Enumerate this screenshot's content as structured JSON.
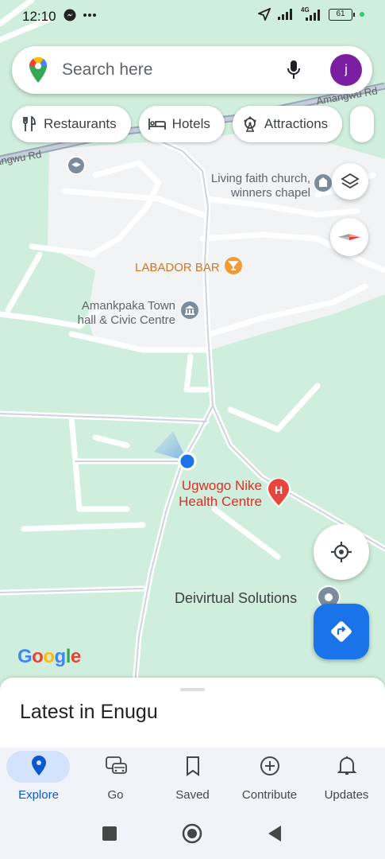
{
  "status_bar": {
    "time": "12:10",
    "network": "4G",
    "battery": "61",
    "icons": [
      "messenger-icon",
      "more-dots-icon",
      "location-arrow-icon",
      "signal-icon",
      "signal-4g-icon",
      "battery-icon"
    ]
  },
  "search": {
    "placeholder": "Search here",
    "avatar_letter": "j",
    "avatar_color": "#7b1fa2"
  },
  "chips": [
    {
      "label": "Restaurants",
      "icon": "fork-knife-icon"
    },
    {
      "label": "Hotels",
      "icon": "bed-icon"
    },
    {
      "label": "Attractions",
      "icon": "ferris-wheel-icon"
    }
  ],
  "map": {
    "road_labels": [
      "Amangwu Rd",
      "angwu Rd"
    ],
    "places": [
      {
        "name": "Living faith church,",
        "name2": "winners chapel",
        "icon": "church-icon"
      },
      {
        "name": "LABADOR BAR",
        "icon": "cocktail-icon"
      },
      {
        "name": "Amankpaka Town",
        "name2": "hall & Civic Centre",
        "icon": "city-hall-icon"
      },
      {
        "name": "Ugwogo Nike",
        "name2": "Health Centre",
        "icon": "hospital-icon"
      },
      {
        "name": "Deivirtual Solutions",
        "icon": "place-pin-icon"
      }
    ],
    "attribution": "Google"
  },
  "sheet": {
    "title": "Latest in Enugu"
  },
  "nav": [
    {
      "label": "Explore",
      "icon": "explore-pin-icon",
      "active": true
    },
    {
      "label": "Go",
      "icon": "car-icon"
    },
    {
      "label": "Saved",
      "icon": "bookmark-icon"
    },
    {
      "label": "Contribute",
      "icon": "add-circle-icon"
    },
    {
      "label": "Updates",
      "icon": "bell-icon"
    }
  ],
  "colors": {
    "accent": "#1a73e8",
    "map_green": "#cfeedd",
    "map_urban": "#f1f3f4",
    "hospital": "#e8453c",
    "bar": "#f29b34"
  }
}
